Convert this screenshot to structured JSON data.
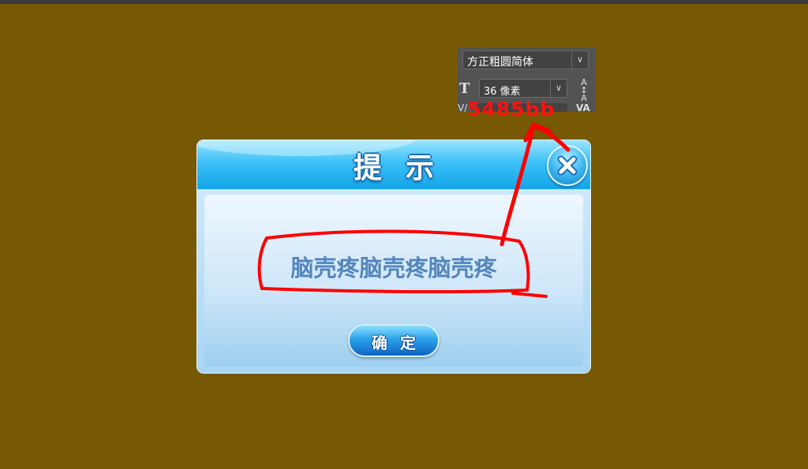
{
  "ps_panel": {
    "font_name": "方正粗圆简体",
    "size_value": "36 像素",
    "size_icon": "font-size-icon",
    "leading_icon": "leading-icon",
    "dropdown_icon": "chevron-down-icon",
    "tracking_left": "V/",
    "tracking_right": "VA"
  },
  "annotation": {
    "hex_color_label": "5485bb",
    "stroke_color": "#ff0000"
  },
  "dialog": {
    "title": "提示",
    "message": "脑壳疼脑壳疼脑壳疼",
    "confirm_label": "确定",
    "close_icon": "close-icon",
    "message_color": "#5485bb"
  }
}
